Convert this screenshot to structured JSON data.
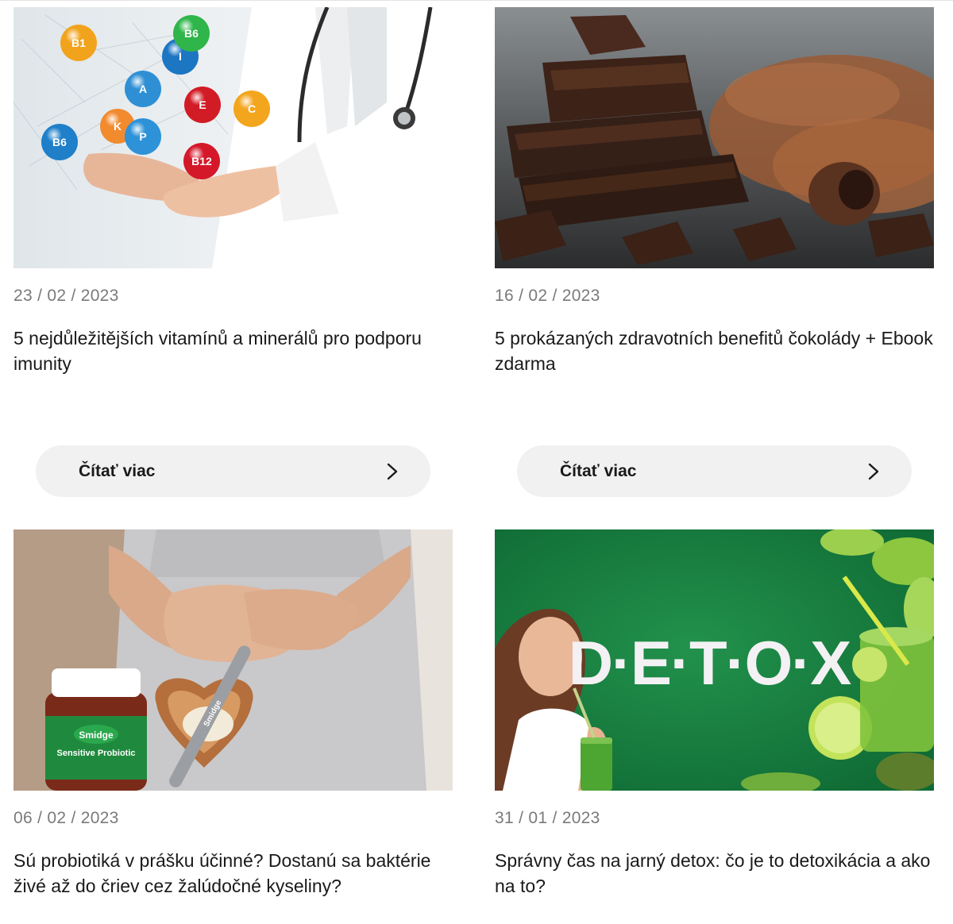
{
  "read_more_label": "Čítať viac",
  "articles": [
    {
      "date": "23 / 02 / 2023",
      "title": "5 nejdůležitějších vitamínů a minerálů pro podporu imunity",
      "image": "doctor-vitamins-image"
    },
    {
      "date": "16 / 02 / 2023",
      "title": "5 prokázaných zdravotních benefitů čokolády + Ebook zdarma",
      "image": "chocolate-image"
    },
    {
      "date": "06 / 02 / 2023",
      "title": "Sú probiotiká v prášku účinné? Dostanú sa baktérie živé až do čriev cez žalúdočné kyseliny?",
      "image": "probiotic-powder-image"
    },
    {
      "date": "31 / 01 / 2023",
      "title": "Správny čas na jarný detox: čo je to detoxikácia a ako na to?",
      "image": "detox-image"
    }
  ],
  "image_text": {
    "vitamins": [
      "B1",
      "B6",
      "A",
      "K",
      "P",
      "I",
      "B6",
      "E",
      "C",
      "B12"
    ],
    "jar_brand": "Smidge",
    "jar_product": "Sensitive Probiotic",
    "spoon_brand": "Smidge",
    "detox_word": "D·E·T·O·X"
  },
  "colors": {
    "date": "#7a7a7a",
    "title": "#1a1a1a",
    "button_bg": "#f1f1f1",
    "detox_green": "#1b7a3e"
  }
}
